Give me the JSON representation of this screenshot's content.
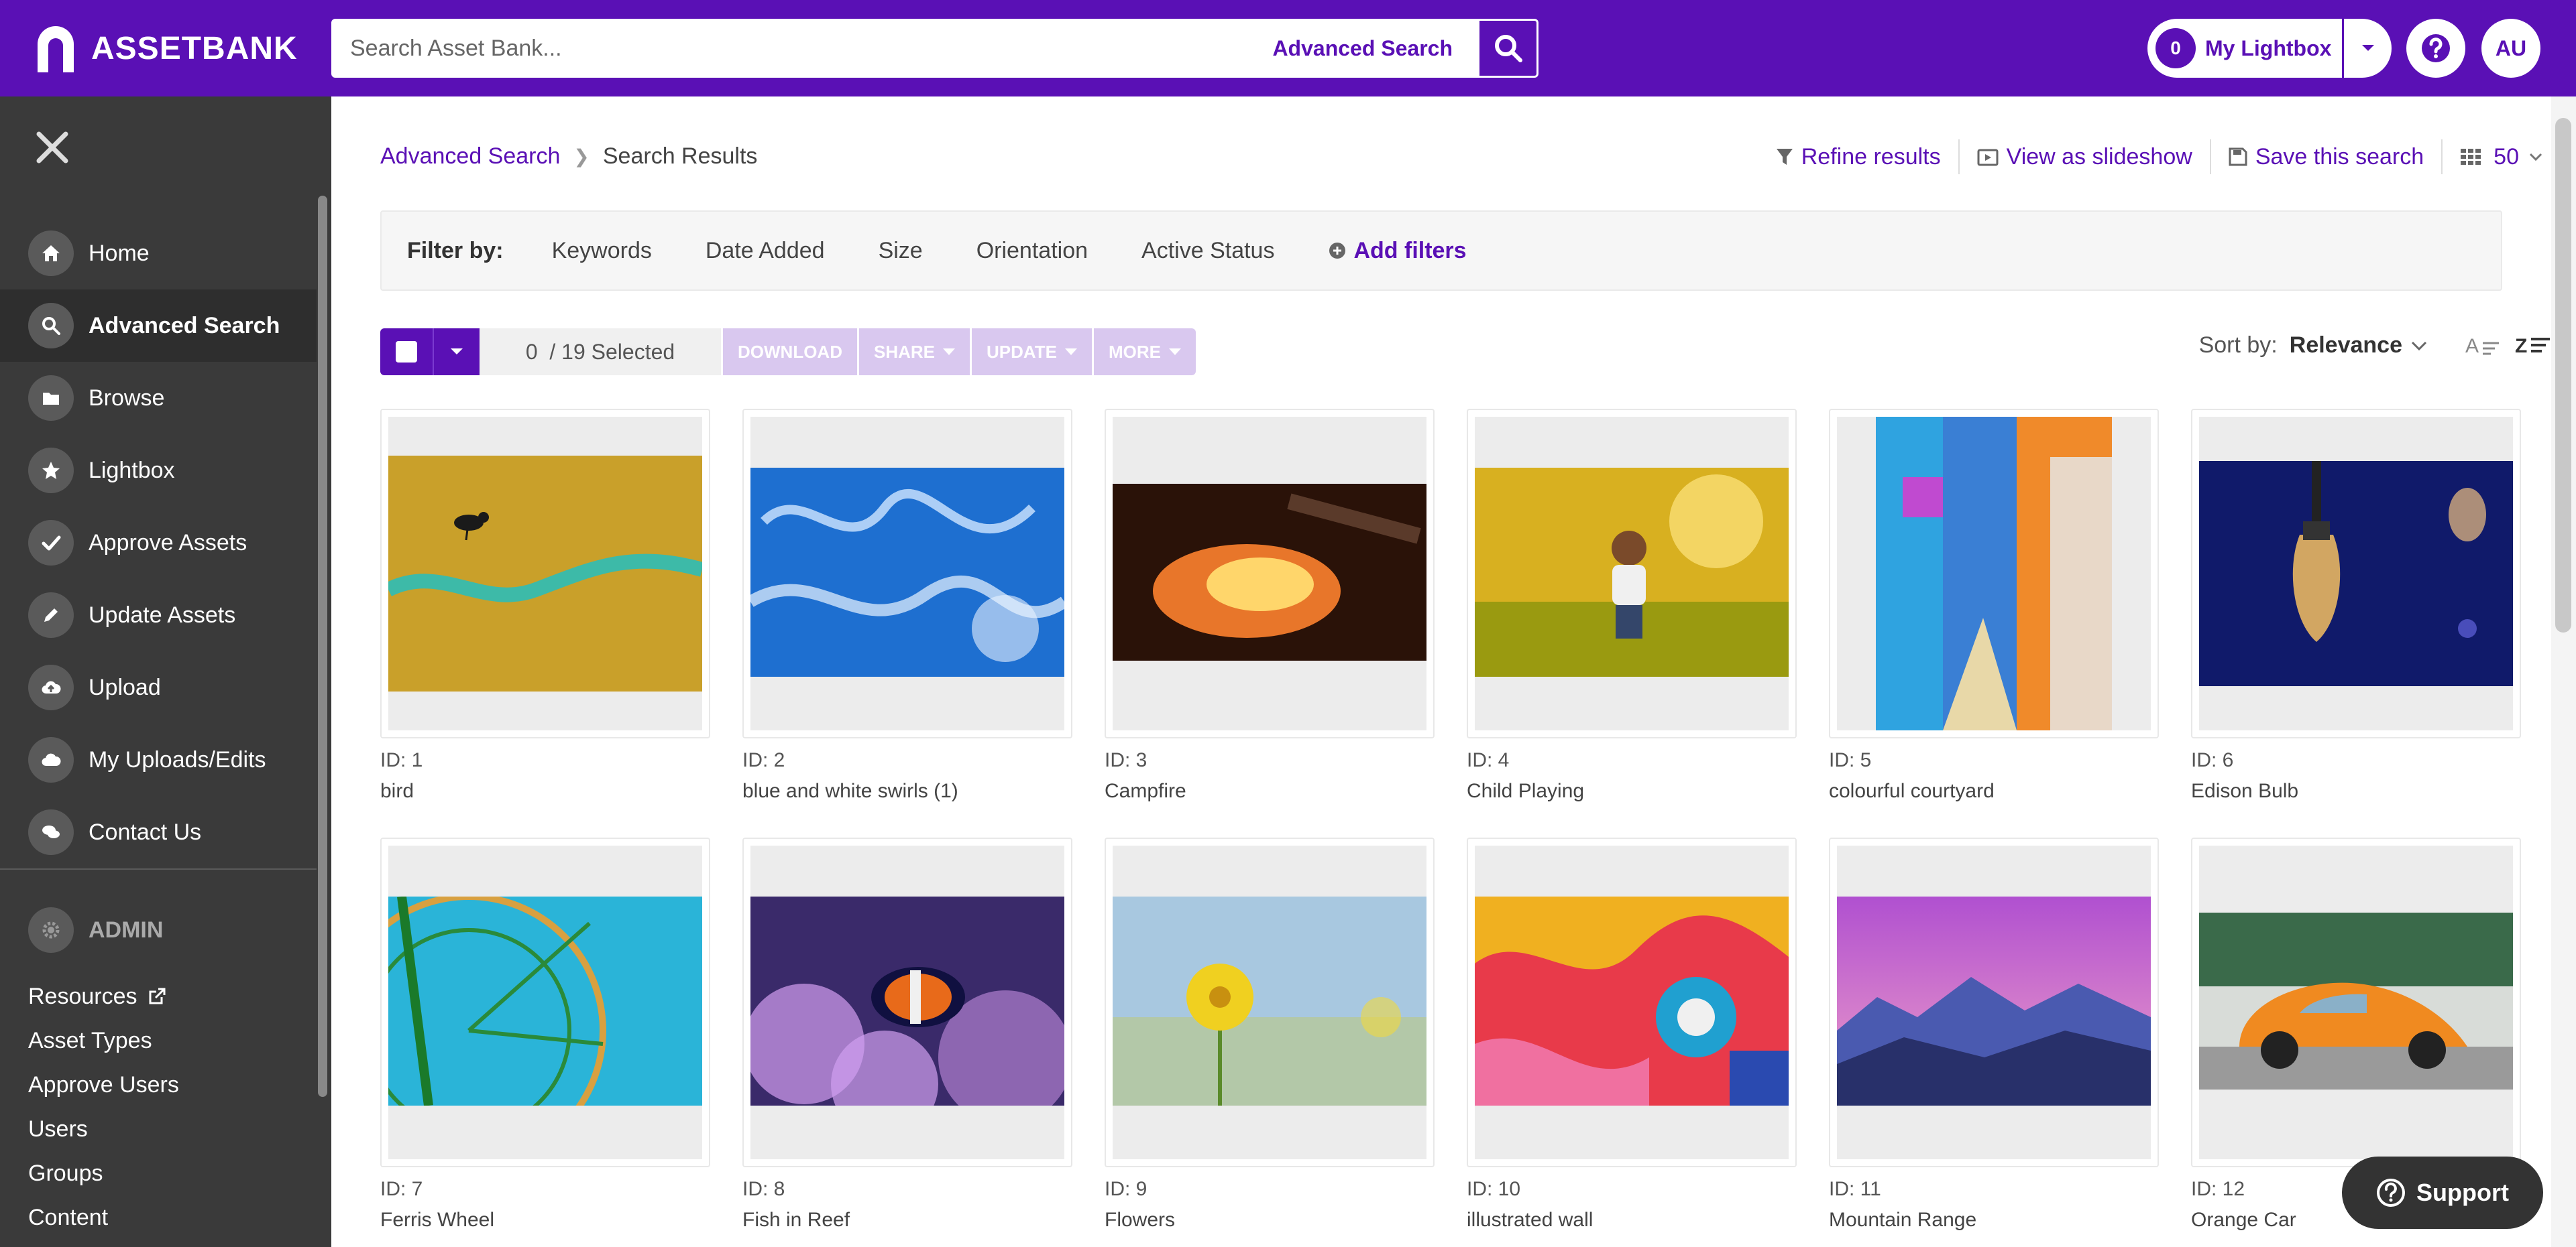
{
  "header": {
    "brand": "ASSETBANK",
    "search_placeholder": "Search Asset Bank...",
    "advanced_search_link": "Advanced Search",
    "lightbox_count": "0",
    "lightbox_label": "My Lightbox",
    "help_icon": "question-icon",
    "user_initials": "AU",
    "accent_color": "#5a10b5"
  },
  "sidebar": {
    "nav": [
      {
        "label": "Home",
        "icon": "home-icon"
      },
      {
        "label": "Advanced Search",
        "icon": "search-icon"
      },
      {
        "label": "Browse",
        "icon": "folder-icon"
      },
      {
        "label": "Lightbox",
        "icon": "star-icon"
      },
      {
        "label": "Approve Assets",
        "icon": "check-icon"
      },
      {
        "label": "Update Assets",
        "icon": "pencil-icon"
      },
      {
        "label": "Upload",
        "icon": "cloud-upload-icon"
      },
      {
        "label": "My Uploads/Edits",
        "icon": "cloud-icon"
      },
      {
        "label": "Contact Us",
        "icon": "chat-icon"
      }
    ],
    "active_index": 1,
    "admin_label": "ADMIN",
    "admin_links": [
      "Resources",
      "Asset Types",
      "Approve Users",
      "Users",
      "Groups",
      "Content"
    ]
  },
  "breadcrumb": {
    "parent": "Advanced Search",
    "current": "Search Results"
  },
  "toolbar": {
    "refine": "Refine results",
    "slideshow": "View as slideshow",
    "save": "Save this search",
    "page_size": "50"
  },
  "filters": {
    "label": "Filter by:",
    "items": [
      "Keywords",
      "Date Added",
      "Size",
      "Orientation",
      "Active Status"
    ],
    "add": "Add filters"
  },
  "actions": {
    "selected_text": "0  / 19 Selected",
    "download": "DOWNLOAD",
    "share": "SHARE",
    "update": "UPDATE",
    "more": "MORE"
  },
  "sort": {
    "label": "Sort by:",
    "value": "Relevance"
  },
  "assets": [
    {
      "id": "ID: 1",
      "title": "bird"
    },
    {
      "id": "ID: 2",
      "title": "blue and white swirls (1)"
    },
    {
      "id": "ID: 3",
      "title": "Campfire"
    },
    {
      "id": "ID: 4",
      "title": "Child Playing"
    },
    {
      "id": "ID: 5",
      "title": "colourful courtyard"
    },
    {
      "id": "ID: 6",
      "title": "Edison Bulb"
    },
    {
      "id": "ID: 7",
      "title": "Ferris Wheel"
    },
    {
      "id": "ID: 8",
      "title": "Fish in Reef"
    },
    {
      "id": "ID: 9",
      "title": "Flowers"
    },
    {
      "id": "ID: 10",
      "title": "illustrated wall"
    },
    {
      "id": "ID: 11",
      "title": "Mountain Range"
    },
    {
      "id": "ID: 12",
      "title": "Orange Car"
    }
  ],
  "support_label": "Support"
}
